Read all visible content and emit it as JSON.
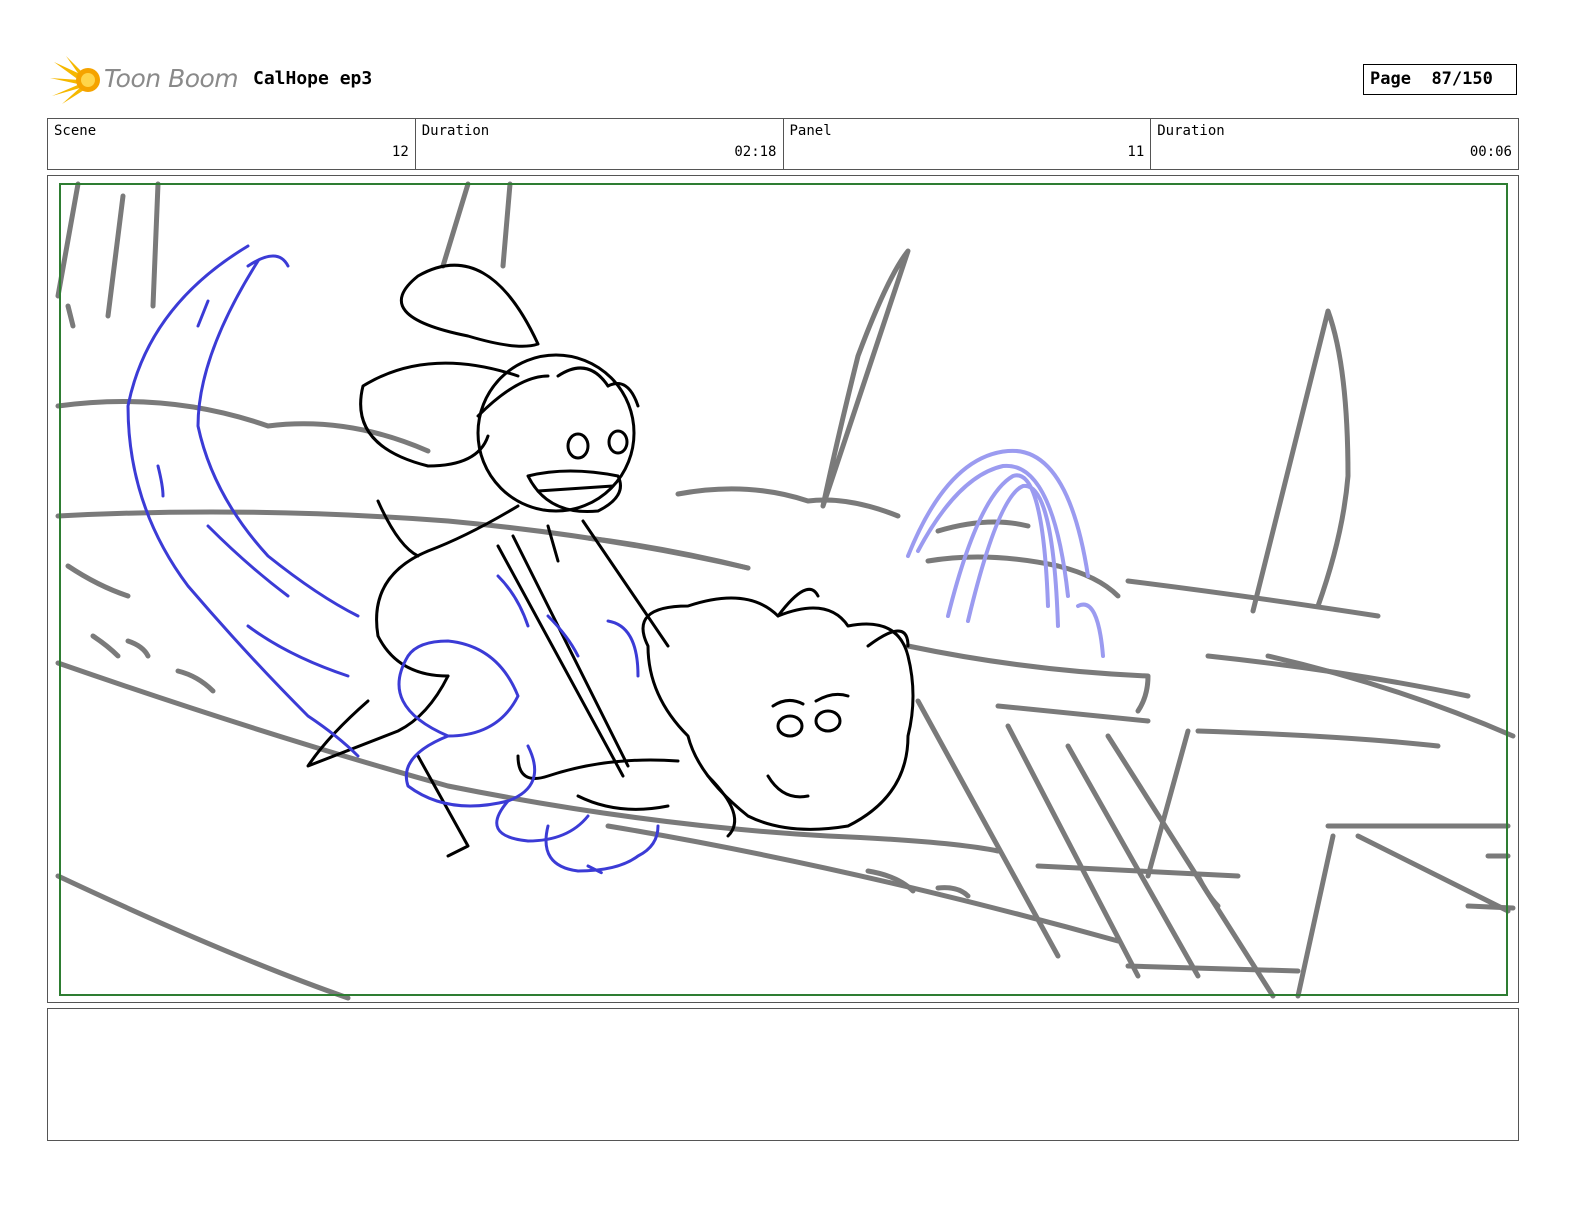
{
  "header": {
    "logo_text": "Toon Boom",
    "project_title": "CalHope ep3",
    "page_label": "Page",
    "page_value": "87/150"
  },
  "info": {
    "scene_label": "Scene",
    "scene_value": "12",
    "scene_duration_label": "Duration",
    "scene_duration_value": "02:18",
    "panel_label": "Panel",
    "panel_value": "11",
    "panel_duration_label": "Duration",
    "panel_duration_value": "00:06"
  },
  "panel": {
    "colors": {
      "background_lines": "#7a7a7a",
      "character_lines": "#000000",
      "water_lines": "#3b3bd6",
      "fountain_water": "#9b9bf0",
      "safe_frame": "#2e7d32"
    }
  },
  "notes": {
    "text": ""
  }
}
